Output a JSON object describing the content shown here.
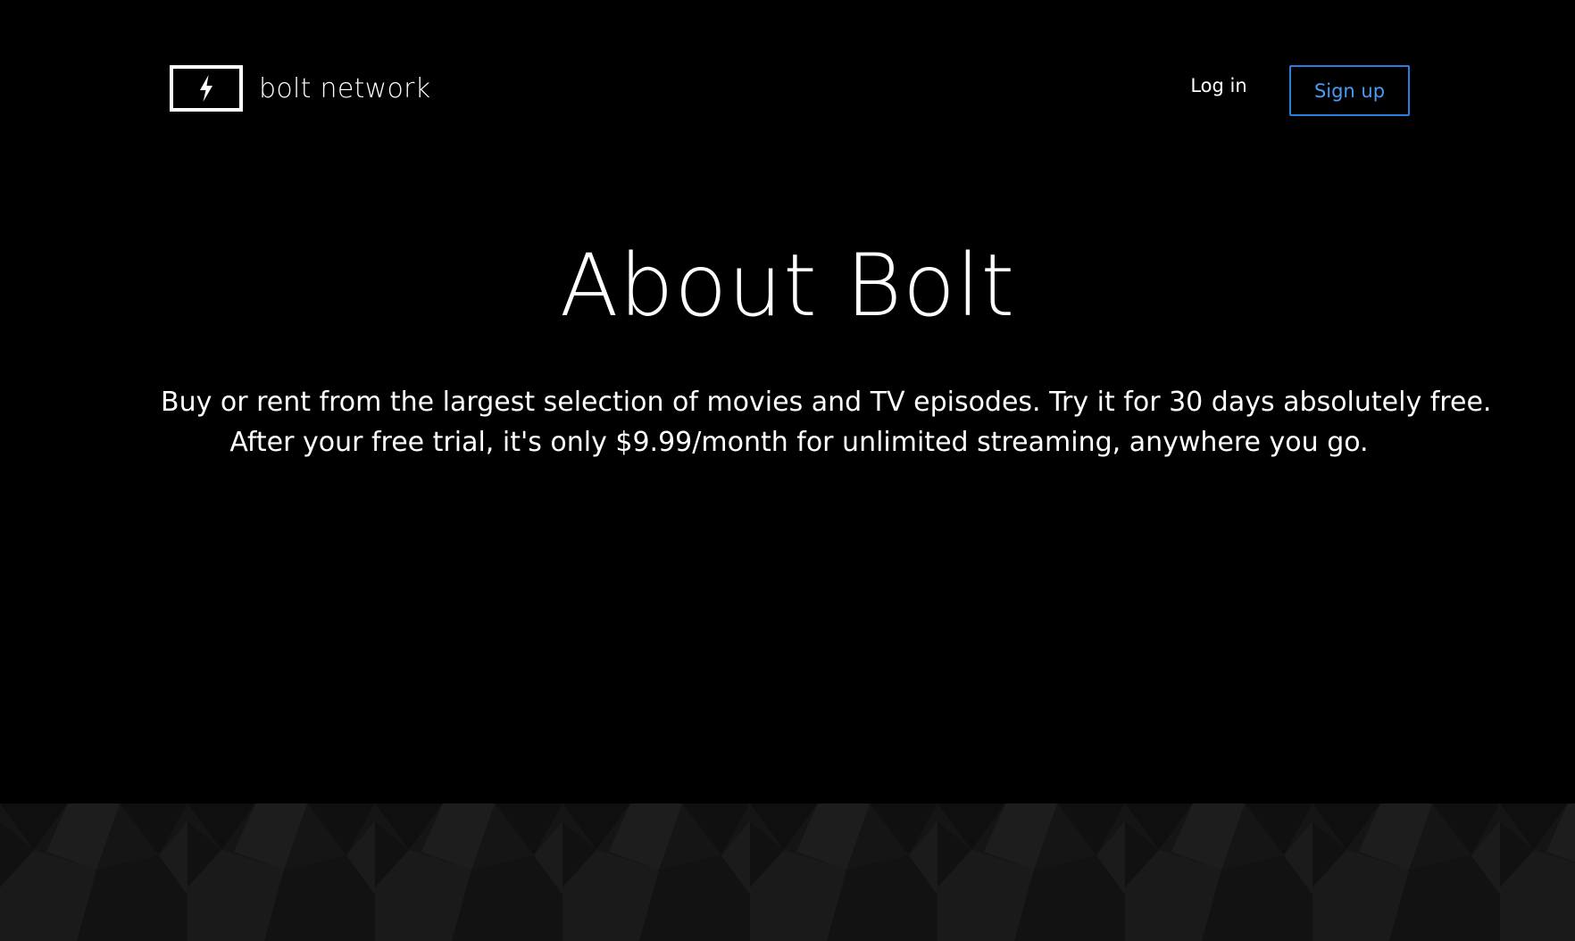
{
  "brand": {
    "logo_icon": "lightning-bolt-icon",
    "name": "bolt network"
  },
  "nav": {
    "login_label": "Log in",
    "signup_label": "Sign up"
  },
  "hero": {
    "title": "About Bolt",
    "description_line_1": "Buy or rent from the largest selection of movies and TV episodes. Try it for 30 days absolutely free.",
    "description_line_2": "After your free trial, it's only $9.99/month for unlimited streaming, anywhere you go."
  },
  "colors": {
    "background": "#000000",
    "text": "#ffffff",
    "signup_accent": "#2a7de1",
    "signup_text": "#4a9cf5",
    "pattern_background": "#161616"
  }
}
